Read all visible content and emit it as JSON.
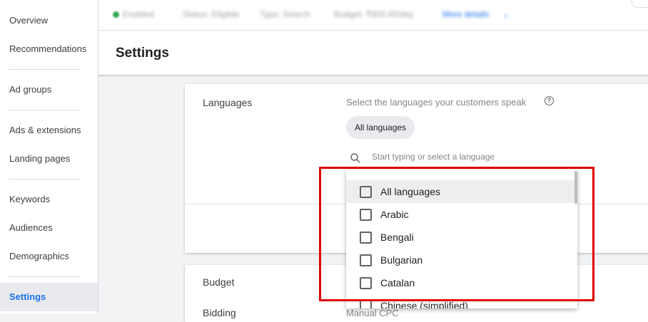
{
  "sidebar": {
    "items": [
      {
        "label": "Overview"
      },
      {
        "label": "Recommendations"
      },
      {
        "label": "Ad groups"
      },
      {
        "label": "Ads & extensions"
      },
      {
        "label": "Landing pages"
      },
      {
        "label": "Keywords"
      },
      {
        "label": "Audiences"
      },
      {
        "label": "Demographics"
      },
      {
        "label": "Settings",
        "active": true
      }
    ]
  },
  "topbar": {
    "status": "Enabled",
    "eligible": "Status: Eligible",
    "type": "Type: Search",
    "budget": "Budget: ₹600.00/day",
    "more": "More details"
  },
  "header": {
    "title": "Settings"
  },
  "languages": {
    "title": "Languages",
    "description": "Select the languages your customers speak",
    "chip": "All languages",
    "search_placeholder": "Start typing or select a language",
    "options": [
      {
        "label": "All languages",
        "highlighted": true
      },
      {
        "label": "Arabic"
      },
      {
        "label": "Bengali"
      },
      {
        "label": "Bulgarian"
      },
      {
        "label": "Catalan"
      },
      {
        "label": "Chinese (simplified)"
      }
    ]
  },
  "budget": {
    "title": "Budget",
    "bidding_title": "Bidding",
    "bidding_value": "Manual CPC"
  },
  "colors": {
    "accent": "#1a73e8",
    "highlight_box": "#e00000"
  }
}
